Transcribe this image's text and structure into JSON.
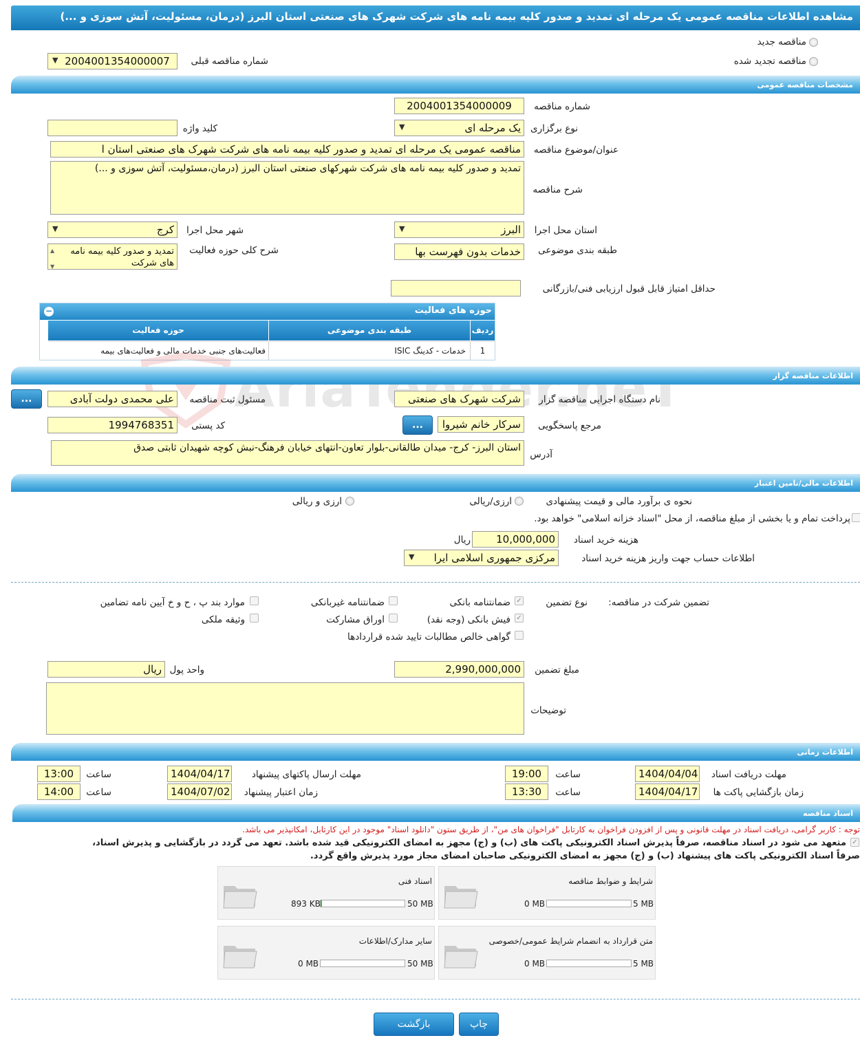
{
  "header": {
    "title": "مشاهده اطلاعات مناقصه عمومی یک مرحله ای تمدید و صدور کلیه بیمه نامه های شرکت شهرک های صنعتی استان البرز (درمان، مسئولیت، آتش سوزی و ...)"
  },
  "top": {
    "new_tender_label": "مناقصه جدید",
    "renewed_tender_label": "مناقصه تجدید شده",
    "prev_number_label": "شماره مناقصه قبلی",
    "prev_number_value": "2004001354000007"
  },
  "sections": {
    "general": "مشخصات مناقصه عمومی",
    "organizer": "اطلاعات مناقصه گزار",
    "financial": "اطلاعات مالی/تامین اعتبار",
    "timing": "اطلاعات زمانی",
    "documents": "اسناد مناقصه"
  },
  "general": {
    "number_label": "شماره مناقصه",
    "number_value": "2004001354000009",
    "type_label": "نوع برگزاری",
    "type_value": "یک مرحله ای",
    "keyword_label": "کلید واژه",
    "keyword_value": "",
    "subject_label": "عنوان/موضوع مناقصه",
    "subject_value": "مناقصه عمومی یک مرحله ای تمدید و صدور کلیه بیمه نامه های شرکت شهرک های صنعتی استان ا",
    "desc_label": "شرح مناقصه",
    "desc_value": "تمدید و صدور کلیه بیمه نامه های شرکت شهرکهای صنعتی استان البرز (درمان،مسئولیت، آتش سوزی و ...)",
    "province_label": "استان محل اجرا",
    "province_value": "البرز",
    "city_label": "شهر محل اجرا",
    "city_value": "کرج",
    "category_label": "طبقه بندی موضوعی",
    "category_value": "خدمات بدون فهرست بها",
    "scope_label": "شرح کلی حوزه فعالیت",
    "scope_value": "تمدید و صدور کلیه بیمه نامه های شرکت",
    "min_score_label": "حداقل امتیاز قابل قبول ارزیابی فنی/بازرگانی",
    "min_score_value": ""
  },
  "activities": {
    "title": "حوزه های فعالیت",
    "columns": [
      "ردیف",
      "طبقه بندی موضوعی",
      "حوزه فعالیت"
    ],
    "rows": [
      [
        "1",
        "خدمات - کدینگ ISIC",
        "فعالیت‌های جنبی خدمات مالی و فعالیت‌های بیمه"
      ]
    ]
  },
  "watermark": "AriaTender.neT",
  "organizer": {
    "org_label": "نام دستگاه اجرایی مناقصه گزار",
    "org_value": "شرکت شهرک های صنعتی",
    "officer_label": "مسئول ثبت مناقصه",
    "officer_value": "علی محمدی دولت آبادی",
    "ref_label": "مرجع پاسخگویی",
    "ref_value": "سرکار خانم شیروا",
    "postal_label": "کد پستی",
    "postal_value": "1994768351",
    "address_label": "آدرس",
    "address_value": "استان البرز- کرج- میدان طالقانی-بلوار تعاون-انتهای خیابان فرهنگ-نبش کوچه شهیدان ثابتی صدق",
    "dots": "..."
  },
  "financial": {
    "estimate_label": "نحوه ی برآورد مالی و قیمت پیشنهادی",
    "opt_rial": "ارزی/ریالی",
    "opt_foreign": "ارزی و ریالی",
    "treasury_text": "پرداخت تمام و یا بخشی از مبلغ مناقصه، از محل \"اسناد خزانه اسلامی\" خواهد بود.",
    "doc_cost_label": "هزینه خرید اسناد",
    "doc_cost_value": "10,000,000",
    "doc_cost_unit": "ریال",
    "account_label": "اطلاعات حساب جهت واریز هزینه خرید اسناد",
    "account_value": "مرکزی جمهوری اسلامی ایرا"
  },
  "guarantee": {
    "label": "تضمین شرکت در مناقصه:",
    "type_label": "نوع تضمین",
    "options": {
      "bank": "ضمانتنامه بانکی",
      "nonbank": "ضمانتنامه غیربانکی",
      "clauses": "موارد بند پ ، ح و خ آیین نامه تضامین",
      "cash": "فیش بانکی (وجه نقد)",
      "bonds": "اوراق مشارکت",
      "property": "وثیقه ملکی",
      "receivables": "گواهی خالص مطالبات تایید شده قراردادها"
    },
    "amount_label": "مبلغ تضمین",
    "amount_value": "2,990,000,000",
    "currency_label": "واحد پول",
    "currency_value": "ریال",
    "notes_label": "توضیحات",
    "notes_value": ""
  },
  "timing": {
    "receive_label": "مهلت دریافت اسناد",
    "receive_date": "1404/04/04",
    "receive_time": "19:00",
    "send_label": "مهلت ارسال پاکتهای پیشنهاد",
    "send_date": "1404/04/17",
    "send_time": "13:00",
    "open_label": "زمان بازگشایی پاکت ها",
    "open_date": "1404/04/17",
    "open_time": "13:30",
    "validity_label": "زمان اعتبار پیشنهاد",
    "validity_date": "1404/07/02",
    "validity_time": "14:00",
    "time_label": "ساعت"
  },
  "documents": {
    "notice": "توجه : کاربر گرامی، دریافت اسناد در مهلت قانونی و پس از افزودن فراخوان به کارتابل \"فراخوان های من\"، از طریق ستون \"دانلود اسناد\" موجود در این کارتابل، امکانپذیر می باشد.",
    "commit_line1": "متعهد می شود در اسناد مناقصه، صرفاً پذیرش اسناد الکترونیکی پاکت های (ب) و (ج) مجهز به امضای الکترونیکی قید شده باشد. تعهد می گردد در بازگشایی و پذیرش اسناد،",
    "commit_line2": "صرفاً اسناد الکترونیکی پاکت های پیشنهاد (ب) و (ج) مجهز به امضای الکترونیکی صاحبان امضای مجاز مورد پذیرش واقع گردد.",
    "cards": [
      {
        "name": "شرایط و ضوابط مناقصه",
        "used": "0 MB",
        "max": "5 MB",
        "fill": 0
      },
      {
        "name": "اسناد فنی",
        "used": "893 KB",
        "max": "50 MB",
        "fill": 0.017
      },
      {
        "name": "متن قرارداد به انضمام شرایط عمومی/خصوصی",
        "used": "0 MB",
        "max": "5 MB",
        "fill": 0
      },
      {
        "name": "سایر مدارک/اطلاعات",
        "used": "0 MB",
        "max": "50 MB",
        "fill": 0
      }
    ]
  },
  "buttons": {
    "print": "چاپ",
    "back": "بازگشت"
  }
}
